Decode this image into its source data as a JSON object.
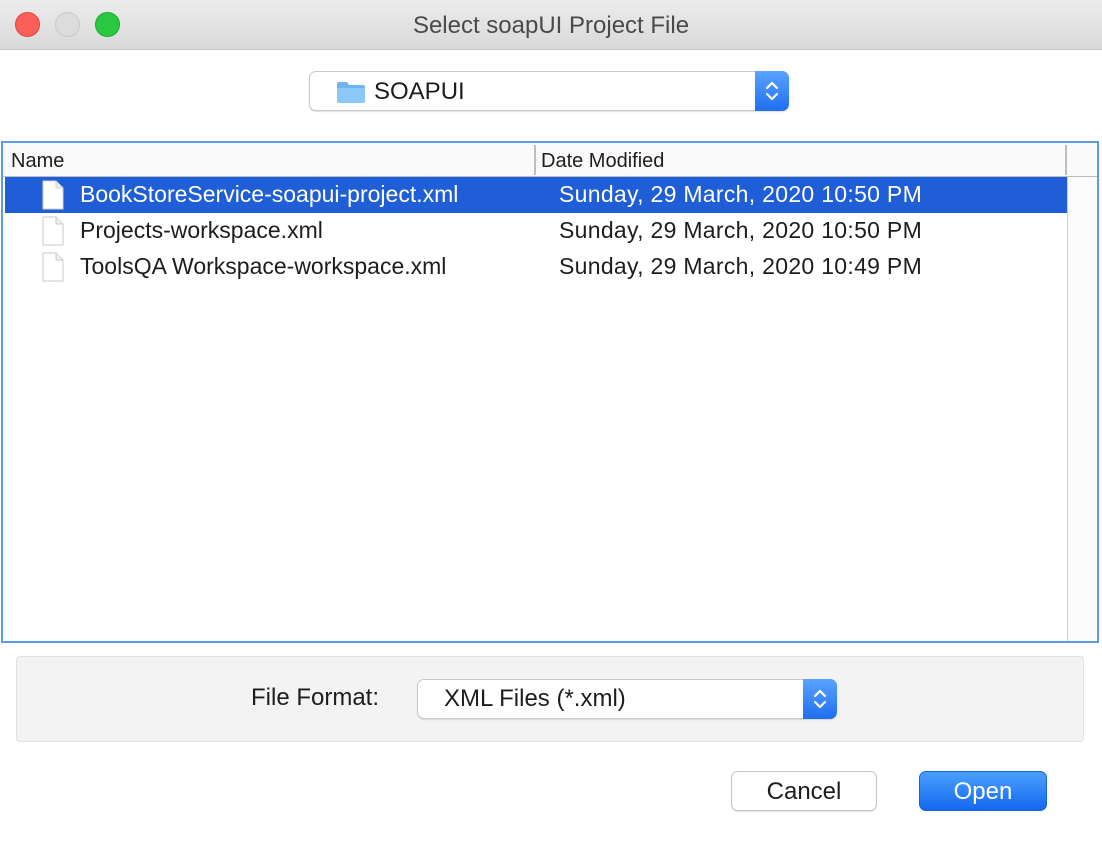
{
  "window": {
    "title": "Select soapUI Project File"
  },
  "folder_selector": {
    "icon": "folder-icon",
    "value": "SOAPUI"
  },
  "file_list": {
    "columns": [
      "Name",
      "Date Modified"
    ],
    "rows": [
      {
        "name": "BookStoreService-soapui-project.xml",
        "date": "Sunday, 29 March, 2020 10:50 PM",
        "selected": true
      },
      {
        "name": "Projects-workspace.xml",
        "date": "Sunday, 29 March, 2020 10:50 PM",
        "selected": false
      },
      {
        "name": "ToolsQA Workspace-workspace.xml",
        "date": "Sunday, 29 March, 2020 10:49 PM",
        "selected": false
      }
    ]
  },
  "file_format": {
    "label": "File Format:",
    "value": "XML Files (*.xml)"
  },
  "buttons": {
    "cancel": "Cancel",
    "open": "Open"
  },
  "colors": {
    "selection": "#1f5ed6",
    "accent": "#1f6ff0",
    "list_border": "#5b9be8"
  }
}
